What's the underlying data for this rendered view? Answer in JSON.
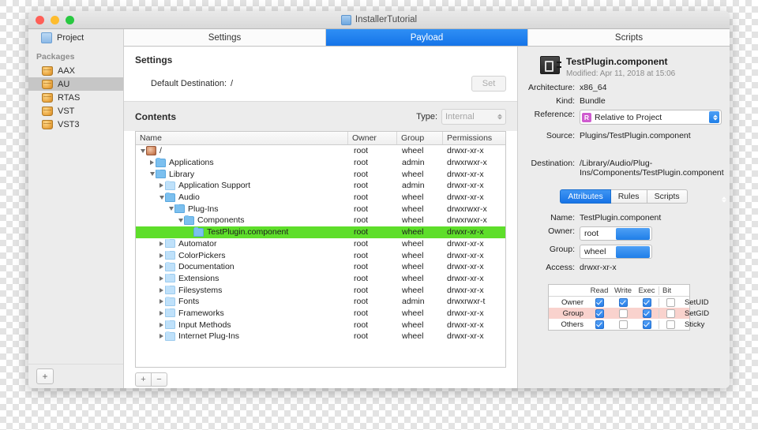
{
  "window": {
    "title": "InstallerTutorial",
    "traffic_lights": [
      "close-button",
      "minimize-button",
      "zoom-button"
    ]
  },
  "sidebar": {
    "project_label": "Project",
    "section_header": "Packages",
    "items": [
      {
        "label": "AAX",
        "selected": false
      },
      {
        "label": "AU",
        "selected": true
      },
      {
        "label": "RTAS",
        "selected": false
      },
      {
        "label": "VST",
        "selected": false
      },
      {
        "label": "VST3",
        "selected": false
      }
    ],
    "add_button": "+"
  },
  "tabs": [
    {
      "label": "Settings",
      "active": false
    },
    {
      "label": "Payload",
      "active": true
    },
    {
      "label": "Scripts",
      "active": false
    }
  ],
  "settings": {
    "title": "Settings",
    "default_destination_label": "Default Destination:",
    "default_destination_value": "/",
    "set_button": "Set"
  },
  "contents": {
    "title": "Contents",
    "type_label": "Type:",
    "type_value": "Internal",
    "columns": [
      "Name",
      "Owner",
      "Group",
      "Permissions"
    ],
    "rows": [
      {
        "name": "/",
        "indent": 0,
        "disclosure": "open",
        "icon": "disk-icon",
        "owner": "root",
        "group": "wheel",
        "permissions": "drwxr-xr-x",
        "selected": false
      },
      {
        "name": "Applications",
        "indent": 1,
        "disclosure": "closed",
        "icon": "folder-icon-dark",
        "owner": "root",
        "group": "admin",
        "permissions": "drwxrwxr-x",
        "selected": false
      },
      {
        "name": "Library",
        "indent": 1,
        "disclosure": "open",
        "icon": "folder-icon-dark",
        "owner": "root",
        "group": "wheel",
        "permissions": "drwxr-xr-x",
        "selected": false
      },
      {
        "name": "Application Support",
        "indent": 2,
        "disclosure": "closed",
        "icon": "folder-icon",
        "owner": "root",
        "group": "admin",
        "permissions": "drwxr-xr-x",
        "selected": false
      },
      {
        "name": "Audio",
        "indent": 2,
        "disclosure": "open",
        "icon": "folder-icon-dark",
        "owner": "root",
        "group": "wheel",
        "permissions": "drwxr-xr-x",
        "selected": false
      },
      {
        "name": "Plug-Ins",
        "indent": 3,
        "disclosure": "open",
        "icon": "folder-icon-dark",
        "owner": "root",
        "group": "wheel",
        "permissions": "drwxrwxr-x",
        "selected": false
      },
      {
        "name": "Components",
        "indent": 4,
        "disclosure": "open",
        "icon": "folder-icon-dark",
        "owner": "root",
        "group": "wheel",
        "permissions": "drwxrwxr-x",
        "selected": false
      },
      {
        "name": "TestPlugin.component",
        "indent": 5,
        "disclosure": "none",
        "icon": "folder-icon-dark",
        "owner": "root",
        "group": "wheel",
        "permissions": "drwxr-xr-x",
        "selected": true
      },
      {
        "name": "Automator",
        "indent": 2,
        "disclosure": "closed",
        "icon": "folder-icon",
        "owner": "root",
        "group": "wheel",
        "permissions": "drwxr-xr-x",
        "selected": false
      },
      {
        "name": "ColorPickers",
        "indent": 2,
        "disclosure": "closed",
        "icon": "folder-icon",
        "owner": "root",
        "group": "wheel",
        "permissions": "drwxr-xr-x",
        "selected": false
      },
      {
        "name": "Documentation",
        "indent": 2,
        "disclosure": "closed",
        "icon": "folder-icon",
        "owner": "root",
        "group": "wheel",
        "permissions": "drwxr-xr-x",
        "selected": false
      },
      {
        "name": "Extensions",
        "indent": 2,
        "disclosure": "closed",
        "icon": "folder-icon",
        "owner": "root",
        "group": "wheel",
        "permissions": "drwxr-xr-x",
        "selected": false
      },
      {
        "name": "Filesystems",
        "indent": 2,
        "disclosure": "closed",
        "icon": "folder-icon",
        "owner": "root",
        "group": "wheel",
        "permissions": "drwxr-xr-x",
        "selected": false
      },
      {
        "name": "Fonts",
        "indent": 2,
        "disclosure": "closed",
        "icon": "folder-icon",
        "owner": "root",
        "group": "admin",
        "permissions": "drwxrwxr-t",
        "selected": false
      },
      {
        "name": "Frameworks",
        "indent": 2,
        "disclosure": "closed",
        "icon": "folder-icon",
        "owner": "root",
        "group": "wheel",
        "permissions": "drwxr-xr-x",
        "selected": false
      },
      {
        "name": "Input Methods",
        "indent": 2,
        "disclosure": "closed",
        "icon": "folder-icon",
        "owner": "root",
        "group": "wheel",
        "permissions": "drwxr-xr-x",
        "selected": false
      },
      {
        "name": "Internet Plug-Ins",
        "indent": 2,
        "disclosure": "closed",
        "icon": "folder-icon",
        "owner": "root",
        "group": "wheel",
        "permissions": "drwxr-xr-x",
        "selected": false
      }
    ],
    "add_button": "+",
    "remove_button": "−"
  },
  "inspector": {
    "file_name": "TestPlugin.component",
    "modified": "Modified:  Apr 11, 2018 at 15:06",
    "architecture_label": "Architecture:",
    "architecture_value": "x86_64",
    "kind_label": "Kind:",
    "kind_value": "Bundle",
    "reference_label": "Reference:",
    "reference_badge": "R",
    "reference_value": "Relative to Project",
    "source_label": "Source:",
    "source_value": "Plugins/TestPlugin.component",
    "destination_label": "Destination:",
    "destination_value": "/Library/Audio/Plug-Ins/Components/TestPlugin.component",
    "segments": [
      {
        "label": "Attributes",
        "active": true
      },
      {
        "label": "Rules",
        "active": false
      },
      {
        "label": "Scripts",
        "active": false
      }
    ],
    "name_label": "Name:",
    "name_value": "TestPlugin.component",
    "owner_label": "Owner:",
    "owner_value": "root",
    "group_label": "Group:",
    "group_value": "wheel",
    "access_label": "Access:",
    "access_value": "drwxr-xr-x",
    "permissions_matrix": {
      "columns": [
        "Read",
        "Write",
        "Exec"
      ],
      "bit_column": "Bit",
      "rows": [
        {
          "label": "Owner",
          "read": true,
          "write": true,
          "exec": true,
          "bit_checked": false,
          "bit_label": "SetUID",
          "highlight": false
        },
        {
          "label": "Group",
          "read": true,
          "write": false,
          "exec": true,
          "bit_checked": false,
          "bit_label": "SetGID",
          "highlight": true
        },
        {
          "label": "Others",
          "read": true,
          "write": false,
          "exec": true,
          "bit_checked": false,
          "bit_label": "Sticky",
          "highlight": false
        }
      ]
    }
  },
  "colors": {
    "selection_green": "#5ede2a",
    "accent_blue": "#1574e8",
    "setgid_highlight": "#f9d2cd",
    "reference_badge": "#cf5bcf"
  }
}
